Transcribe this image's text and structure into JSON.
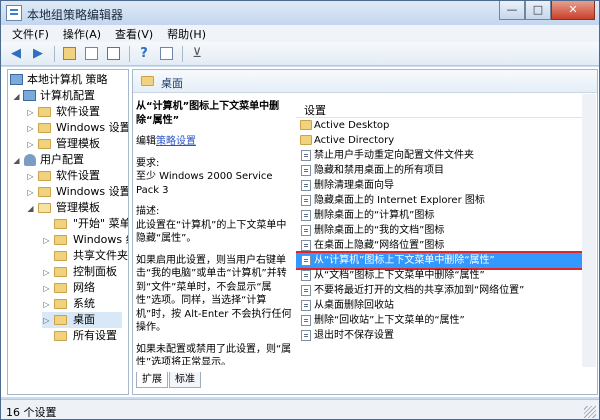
{
  "window": {
    "title": "本地组策略编辑器",
    "minimize": "—",
    "maximize": "□",
    "close": "✕"
  },
  "menu": [
    "文件(F)",
    "操作(A)",
    "查看(V)",
    "帮助(H)"
  ],
  "toolbar": {
    "back_icon": "◀",
    "forward_icon": "▶",
    "help_icon": "?",
    "filter_icon": "⊻"
  },
  "tree": {
    "root": "本地计算机 策略",
    "computer_config": "计算机配置",
    "software_settings": "软件设置",
    "windows_settings": "Windows 设置",
    "admin_templates": "管理模板",
    "user_config": "用户配置",
    "u_software_settings": "软件设置",
    "u_windows_settings": "Windows 设置",
    "u_admin_templates": "管理模板",
    "start_menu": "\"开始\" 菜单",
    "windows_components": "Windows 组",
    "shared_folders": "共享文件夹",
    "control_panel": "控制面板",
    "network": "网络",
    "system": "系统",
    "desktop": "桌面",
    "all_settings": "所有设置"
  },
  "right": {
    "header": "桌面",
    "policy_title": "从“计算机”图标上下文菜单中删除“属性”",
    "edit_prefix": "编辑",
    "edit_link": "策略设置",
    "requirement_label": "要求:",
    "requirement": "至少 Windows 2000 Service Pack 3",
    "desc_label": "描述:",
    "desc1": "此设置在“计算机”的上下文菜单中隐藏“属性”。",
    "desc2": "如果启用此设置，则当用户右键单击“我的电脑”或单击“计算机”并转到“文件”菜单时，不会显示“属性”选项。同样，当选择“计算机”时，按 Alt-Enter 不会执行任何操作。",
    "desc3": "如果未配置或禁用了此设置，则“属性”选项将正常显示。",
    "list_header": "设置",
    "items": [
      "Active Desktop",
      "Active Directory",
      "禁止用户手动重定向配置文件文件夹",
      "隐藏和禁用桌面上的所有项目",
      "删除清理桌面向导",
      "隐藏桌面上的 Internet Explorer 图标",
      "删除桌面上的“计算机”图标",
      "删除桌面上的“我的文档”图标",
      "在桌面上隐藏“网络位置”图标",
      "从“计算机”图标上下文菜单中删除“属性”",
      "从“文档”图标上下文菜单中删除“属性”",
      "不要将最近打开的文档的共享添加到“网络位置”",
      "从桌面删除回收站",
      "删除“回收站”上下文菜单的“属性”",
      "退出时不保存设置"
    ],
    "tab_extended": "扩展",
    "tab_standard": "标准"
  },
  "status": "16 个设置",
  "colors": {
    "selection": "#3399ff",
    "highlight_border": "#e0262a"
  }
}
